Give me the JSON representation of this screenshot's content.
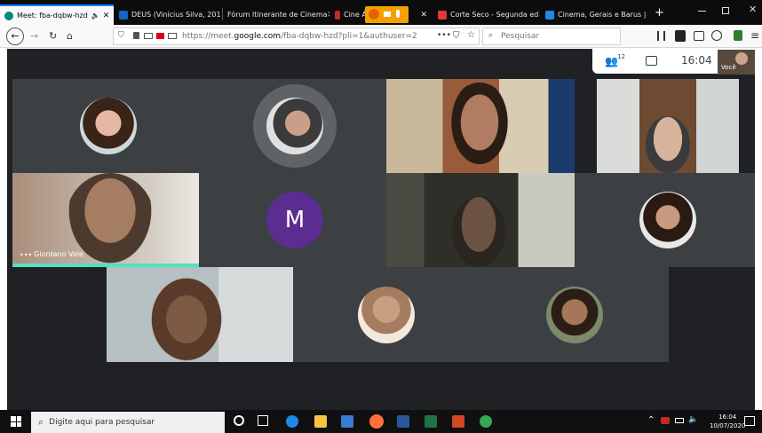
{
  "browser": {
    "tabs": [
      {
        "label": "Meet: fba-dqbw-hzd",
        "active": true
      },
      {
        "label": "DEUS (Vinícius Silva, 201"
      },
      {
        "label": "Fórum Itinerante de Cinema"
      },
      {
        "label": "Cine Á"
      },
      {
        "label": "Corte Seco - Segunda ed"
      },
      {
        "label": "Cinema, Gerais e Barus |"
      }
    ],
    "url_prefix": "https://meet.",
    "url_domain": "google.com",
    "url_rest": "/fba-dqbw-hzd?pli=1&authuser=2",
    "search_placeholder": "Pesquisar",
    "new_tab": "+",
    "more": "•••"
  },
  "meet": {
    "participants_count": "12",
    "clock": "16:04",
    "self_label": "Você",
    "tile_name": "Giordano Vale",
    "placeholder_initial": "M",
    "placeholder_color": "#5c2d91"
  },
  "taskbar": {
    "search_placeholder": "Digite aqui para pesquisar",
    "time": "16:04",
    "date": "10/07/2020"
  },
  "colors": {
    "accent": "#0a84ff",
    "meet_bg": "#202124",
    "speaking": "#4fe3c1"
  }
}
